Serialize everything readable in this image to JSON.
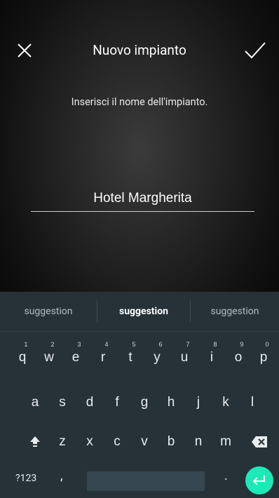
{
  "header": {
    "title": "Nuovo impianto",
    "close_icon": "close-icon",
    "confirm_icon": "checkmark-icon"
  },
  "form": {
    "instruction": "Inserisci il nome dell'impianto.",
    "name_value": "Hotel Margherita"
  },
  "keyboard": {
    "suggestions": [
      "suggestion",
      "suggestion",
      "suggestion"
    ],
    "row1": [
      {
        "key": "q",
        "hint": "1"
      },
      {
        "key": "w",
        "hint": "2"
      },
      {
        "key": "e",
        "hint": "3"
      },
      {
        "key": "r",
        "hint": "4"
      },
      {
        "key": "t",
        "hint": "5"
      },
      {
        "key": "y",
        "hint": "6"
      },
      {
        "key": "u",
        "hint": "7"
      },
      {
        "key": "i",
        "hint": "8"
      },
      {
        "key": "o",
        "hint": "9"
      },
      {
        "key": "p",
        "hint": "0"
      }
    ],
    "row2": [
      "a",
      "s",
      "d",
      "f",
      "g",
      "h",
      "j",
      "k",
      "l"
    ],
    "row3": [
      "z",
      "x",
      "c",
      "v",
      "b",
      "n",
      "m"
    ],
    "symbols_label": "?123",
    "comma_label": ",",
    "period_label": ".",
    "accent_color": "#1de9b6",
    "background_color": "#263238"
  }
}
